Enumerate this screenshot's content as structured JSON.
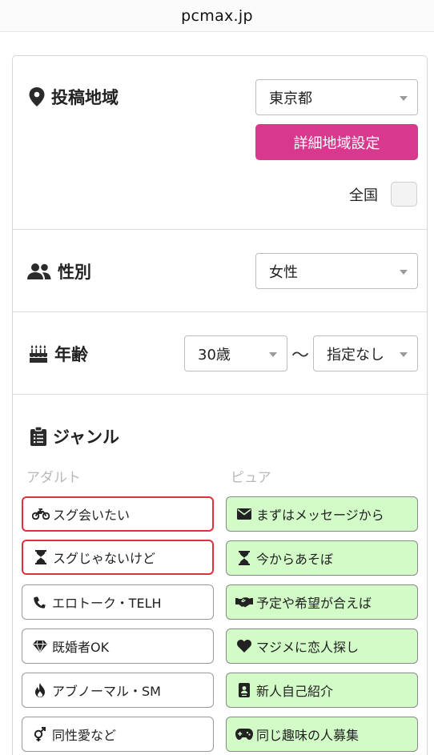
{
  "browser": {
    "url": "pcmax.jp"
  },
  "region": {
    "title": "投稿地域",
    "icon": "map-marker-icon",
    "selected": "東京都",
    "detail_button": "詳細地域設定",
    "nationwide_label": "全国",
    "nationwide_checked": false
  },
  "gender": {
    "title": "性別",
    "icon": "users-icon",
    "selected": "女性"
  },
  "age": {
    "title": "年齢",
    "icon": "birthday-cake-icon",
    "from": "30歳",
    "separator": "〜",
    "to": "指定なし"
  },
  "genre": {
    "title": "ジャンル",
    "icon": "clipboard-icon",
    "adult_label": "アダルト",
    "pure_label": "ピュア",
    "adult": [
      {
        "label": "スグ会いたい",
        "icon": "motorcycle-icon",
        "selected": true
      },
      {
        "label": "スグじゃないけど",
        "icon": "hourglass-icon",
        "selected": true
      },
      {
        "label": "エロトーク・TELH",
        "icon": "phone-icon",
        "selected": false
      },
      {
        "label": "既婚者OK",
        "icon": "diamond-icon",
        "selected": false
      },
      {
        "label": "アブノーマル・SM",
        "icon": "fire-icon",
        "selected": false
      },
      {
        "label": "同性愛など",
        "icon": "gender-icon",
        "selected": false
      }
    ],
    "pure": [
      {
        "label": "まずはメッセージから",
        "icon": "envelope-icon",
        "selected": true
      },
      {
        "label": "今からあそぼ",
        "icon": "hourglass-icon",
        "selected": true
      },
      {
        "label": "予定や希望が合えば",
        "icon": "handshake-icon",
        "selected": true
      },
      {
        "label": "マジメに恋人探し",
        "icon": "heart-icon",
        "selected": true
      },
      {
        "label": "新人自己紹介",
        "icon": "id-card-icon",
        "selected": true
      },
      {
        "label": "同じ趣味の人募集",
        "icon": "gamepad-icon",
        "selected": true
      }
    ]
  },
  "colors": {
    "accent_pink": "#d9388f",
    "pure_selected_bg": "#d3fbc8",
    "highlight_red": "#e0303c"
  }
}
